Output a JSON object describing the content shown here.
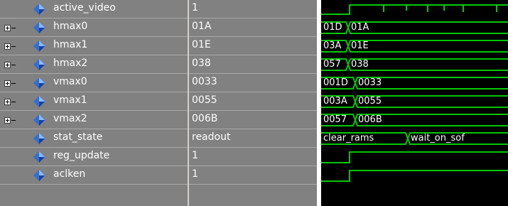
{
  "colors": {
    "pane_bg": "#818181",
    "wave_bg": "#000000",
    "wave_line": "#00c800",
    "wave_text": "#ffffff",
    "row_separator": "#a9a9a9",
    "icon_blue": "#2f6fd6"
  },
  "signals": [
    {
      "name": "active_video",
      "value": "1",
      "expandable": false,
      "icon": "diamond-icon"
    },
    {
      "name": "hmax0",
      "value": "01A",
      "expandable": true,
      "icon": "diamond-icon"
    },
    {
      "name": "hmax1",
      "value": "01E",
      "expandable": true,
      "icon": "diamond-icon"
    },
    {
      "name": "hmax2",
      "value": "038",
      "expandable": true,
      "icon": "diamond-icon"
    },
    {
      "name": "vmax0",
      "value": "0033",
      "expandable": true,
      "icon": "diamond-icon"
    },
    {
      "name": "vmax1",
      "value": "0055",
      "expandable": true,
      "icon": "diamond-icon"
    },
    {
      "name": "vmax2",
      "value": "006B",
      "expandable": true,
      "icon": "diamond-icon"
    },
    {
      "name": "stat_state",
      "value": "readout",
      "expandable": false,
      "icon": "diamond-icon"
    },
    {
      "name": "reg_update",
      "value": "1",
      "expandable": false,
      "icon": "diamond-icon"
    },
    {
      "name": "aclken",
      "value": "1",
      "expandable": false,
      "icon": "diamond-icon"
    }
  ],
  "waves": {
    "hmax0": [
      "01D",
      "01A"
    ],
    "hmax1": [
      "03A",
      "01E"
    ],
    "hmax2": [
      "057",
      "038"
    ],
    "vmax0": [
      "001D",
      "0033"
    ],
    "vmax1": [
      "003A",
      "0055"
    ],
    "vmax2": [
      "0057",
      "006B"
    ],
    "stat_state": [
      "clear_rams",
      "wait_on_sof"
    ]
  }
}
